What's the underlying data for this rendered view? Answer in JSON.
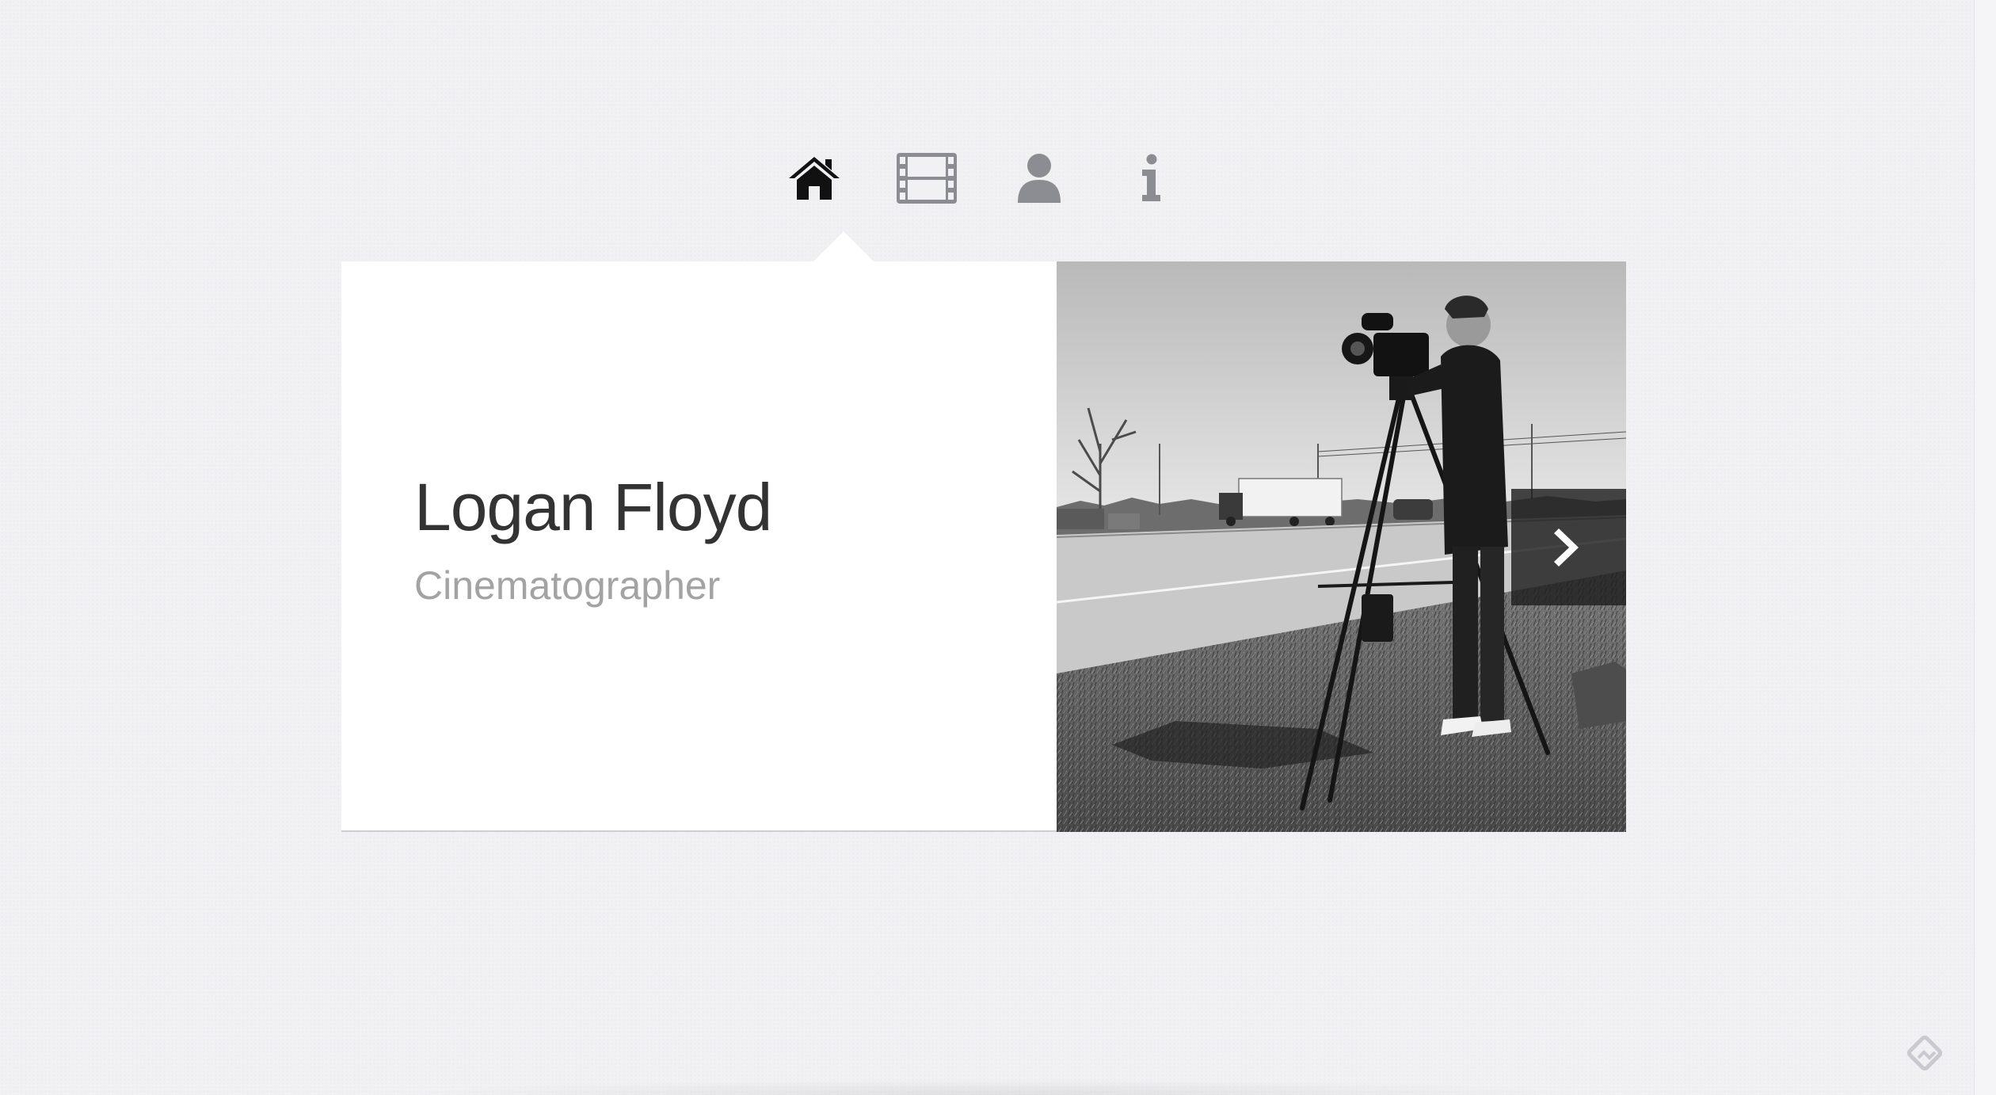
{
  "nav": {
    "items": [
      {
        "icon": "home-icon",
        "active": true
      },
      {
        "icon": "film-icon",
        "active": false
      },
      {
        "icon": "user-icon",
        "active": false
      },
      {
        "icon": "info-icon",
        "active": false
      }
    ],
    "active_color": "#111111",
    "inactive_color": "#8c8c93"
  },
  "profile": {
    "name": "Logan Floyd",
    "role": "Cinematographer"
  },
  "photo": {
    "alt": "Logan Floyd",
    "style": "black-and-white",
    "next_icon": "chevron-right-icon"
  },
  "colors": {
    "page_background": "#f1f1f4",
    "card_background": "#ffffff",
    "name_text": "#333333",
    "role_text": "#a3a3a3",
    "next_button_background": "#1e1e1e"
  }
}
